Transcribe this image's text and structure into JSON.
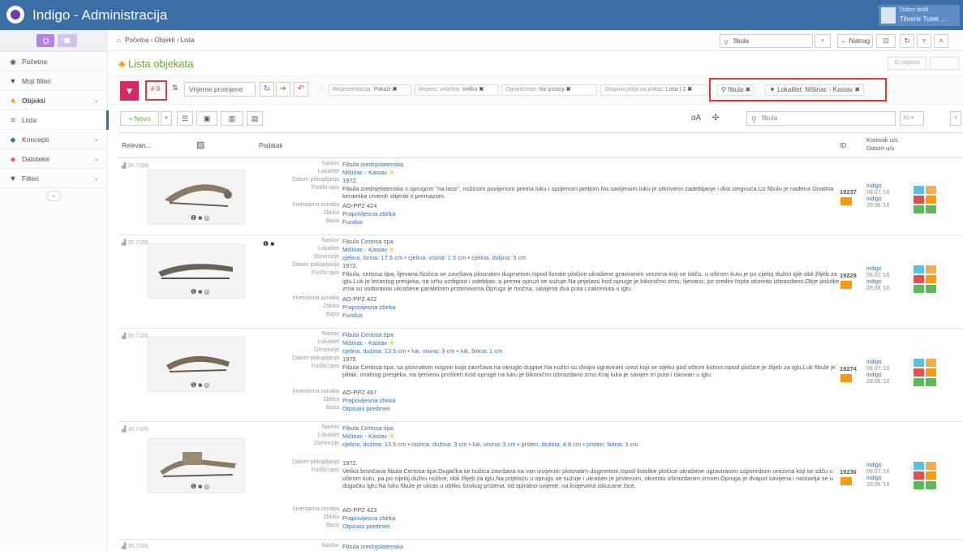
{
  "topbar": {
    "app_title": "Indigo - Administracija",
    "user_greeting": "Dobro došli",
    "user_name": "Tihomir Tutek ..."
  },
  "sidebar": {
    "items": [
      {
        "label": "Početna",
        "icon": "dashboard-icon"
      },
      {
        "label": "Moji filteri",
        "icon": "filter-icon"
      },
      {
        "label": "Objekti",
        "icon": "objects-icon"
      },
      {
        "label": "Lista",
        "icon": "list-icon"
      },
      {
        "label": "Koncepti",
        "icon": "concepts-icon"
      },
      {
        "label": "Datoteke",
        "icon": "files-icon"
      },
      {
        "label": "Filteri",
        "icon": "filter-icon"
      }
    ]
  },
  "breadcrumb": {
    "items": [
      "Početna",
      "Objekti",
      "Lista"
    ]
  },
  "header_search": {
    "value": "fibula"
  },
  "header_buttons": {
    "back": "← Natrag"
  },
  "page": {
    "title": "Lista objekata",
    "id_placeholder": "ID objekta"
  },
  "filterbar": {
    "count": "# 9",
    "sort_label": "Vrijeme promjene",
    "chips": [
      {
        "label": "Reprezentacija:",
        "value": "Pokaži"
      },
      {
        "label": "Reprez. veličina:",
        "value": "Veliko"
      },
      {
        "label": "Ograničenje:",
        "value": "Ne postoji"
      },
      {
        "label": "Skupina polja za prikaz:",
        "value": "Lista | 2"
      }
    ],
    "active_filters": [
      "fibula",
      "Lokalitet: Mišinac - Kastav"
    ]
  },
  "toolbar": {
    "new_label": "+ Novo",
    "search_value": "fibula",
    "right_select": "Bil"
  },
  "table": {
    "headers": {
      "relevance": "Relevan...",
      "data": "Podatak",
      "id": "ID",
      "user": "Korisnik u/s",
      "date": "Datum u/s"
    },
    "rows": [
      {
        "relevance": "35.7189",
        "fields": [
          {
            "label": "Naslov",
            "value": "Fibula srednjolatenska",
            "link": true
          },
          {
            "label": "Lokalitet",
            "value": "Mišinac - Kastav",
            "link": true
          },
          {
            "label": "Datum prikupljanja",
            "value": "1972."
          },
          {
            "label": "Fizički opis",
            "value": "Fibula srednjelatenska s oprugom \"na laso\", nožicom povijenom prema luku i spojenom petljom.Na savijenom luku je otkriveno zadebljanje i dva stegnuća.Uz fibulu je nađena Gnathia keramika crvenih stijenki s premazom.",
            "lines": 2
          },
          {
            "label": "Inventarna oznaka",
            "value": "AO-PPZ 424"
          },
          {
            "label": "Zbirka",
            "value": "Prapovijesna zbirka",
            "link": true
          },
          {
            "label": "Baza",
            "value": "Fundus",
            "link": true
          }
        ],
        "id": "19237",
        "user1": "indigo",
        "date1": "06.07.'16",
        "user2": "indigo",
        "date2": "29.06.'16"
      },
      {
        "relevance": "35.7189",
        "fields": [
          {
            "label": "Naslov",
            "value": "Fibula Certosa tipa",
            "link": true
          },
          {
            "label": "Lokalitet",
            "value": "Mišinac - Kastav",
            "link": true
          },
          {
            "label": "Dimenzije",
            "value": "cjelina, širina: 17.5 cm  • cjelina, visina: 1.5 cm  • cjelina, duljina: 5 cm",
            "link": true
          },
          {
            "label": "Datum prikupljanja",
            "value": "1972."
          },
          {
            "label": "Fizički opis",
            "value": "Fibula, certosa tipa, lijevana.Nožica se završava plosnatim dugmetom.Ispod lisnate pločice ukrašene graviranim urezima koji se ističu, u oštrom kutu je po cijeloj dužini igle obli žlijeb za iglu.Luk je lećastog presjeka, na vrhu uzdignut i odebljao, a prema opruzi se sužuje.Na prijelazu kod opruge je bikonično zrno, lijevano, po sredini hrpta okomito izbrazdano.Obje polutke zrna su vodoravno ukrašene paralelnim prstenovima.Opruga je močna, savijena dva puta i zakrenuta u iglu.",
            "lines": 3
          },
          {
            "label": "Inventarna oznaka",
            "value": "AO-PPZ 422"
          },
          {
            "label": "Zbirka",
            "value": "Prapovijesna zbirka",
            "link": true
          },
          {
            "label": "Baza",
            "value": "Fundus",
            "link": true
          }
        ],
        "id": "19229",
        "user1": "indigo",
        "date1": "06.07.'16",
        "user2": "indigo",
        "date2": "29.06.'16"
      },
      {
        "relevance": "35.7189",
        "fields": [
          {
            "label": "Naslov",
            "value": "Fibula Certosa tipa",
            "link": true
          },
          {
            "label": "Lokalitet",
            "value": "Mišinac - Kastav",
            "link": true
          },
          {
            "label": "Dimenzije",
            "value": "cjelina, dužina: 13.5 cm  • luk, visina: 3 cm  • luk, širina: 1 cm",
            "link": true
          },
          {
            "label": "Datum prikupljanja",
            "value": "1979."
          },
          {
            "label": "Fizički opis",
            "value": "Fibula Certosa tipa, sa plosnatom nogom koja završava na okruglo dugme.Na nožici su dvojni ugravirani urezi koji se sijeku pod oštrim kutom.Ispod pločice je žlijeb za iglu.Luk fibule je plitak, ovalnog presjeka, na tjemenu proširen.Kod opruge na luku je bikonično izbrazdano zrno.Kraj luka je savijen tri puta i iskovan u iglu.",
            "lines": 3
          },
          {
            "label": "Inventarna oznaka",
            "value": "AO-PPZ 467"
          },
          {
            "label": "Zbirka",
            "value": "Prapovijesna zbirka",
            "link": true
          },
          {
            "label": "Baza",
            "value": "Otpisani predmeti",
            "link": true
          }
        ],
        "id": "19274",
        "user1": "indigo",
        "date1": "06.07.'16",
        "user2": "indigo",
        "date2": "29.06.'16"
      },
      {
        "relevance": "35.7189",
        "fields": [
          {
            "label": "Naslov",
            "value": "Fibula Certosa tipa",
            "link": true
          },
          {
            "label": "Lokalitet",
            "value": "Mišinac - Kastav",
            "link": true
          },
          {
            "label": "Dimenzije",
            "value": "cjelina, dužina: 13.5 cm  • nožica, dužina: 3 cm  • luk, visina: 3 cm  • prsten, dužina: 4.8 cm  • prsten, širina: 3 cm",
            "link": true,
            "lines": 2
          },
          {
            "label": "Datum prikupljanja",
            "value": "1972."
          },
          {
            "label": "Fizički opis",
            "value": "Velika brončana fibula Certosa tipa.Dugačka se nožica završava na van izvijenim plosnatim dugmetom.Ispod listolike pločice ukrašene ugraviranim usporednim urezima koji se stiču u oštrom kutu, pa po cijeloj dužini nožice, obli žlijeb za iglu.Na prijelazu u oprugu se sužuje i ukrašen je prstenom, okomito izbrazdanim zrnom.Opruga je dvaput savijena i nastavlja se u dugačku iglu.Na luku fibule je ukras u obliku širokog prstena, od spiralno uvijene, na krajevima iskucane žice.",
            "lines": 4
          },
          {
            "label": "Inventarna oznaka",
            "value": "AO-PPZ 423"
          },
          {
            "label": "Zbirka",
            "value": "Prapovijesna zbirka",
            "link": true
          },
          {
            "label": "Baza",
            "value": "Otpisani predmeti",
            "link": true
          }
        ],
        "id": "19236",
        "user1": "indigo",
        "date1": "06.07.'16",
        "user2": "indigo",
        "date2": "29.06.'16"
      }
    ],
    "partial_row": {
      "relevance": "35.7189",
      "label": "Naslov",
      "value": "Fibula srednjolatenska"
    }
  }
}
